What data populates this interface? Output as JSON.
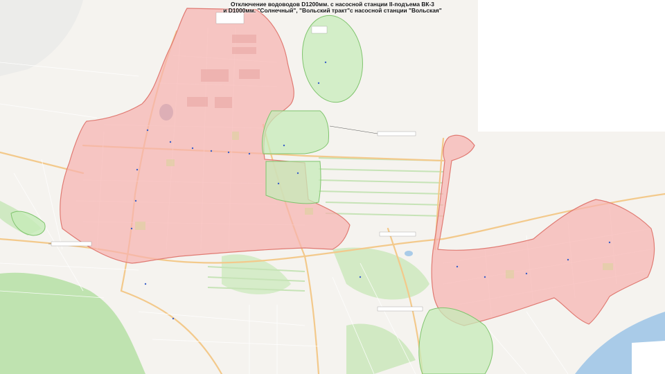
{
  "title": {
    "line1": "Отключение водоводов D1200мм.  с насосной станции II-подъема ВК-3",
    "line2": "и D1000мм. \"Солнечный\", \"Вольский тракт\"с насосной станции \"Вольская\""
  },
  "legend_zones": {
    "affected_fill": "#f6b3b0",
    "affected_stroke": "#e07a72",
    "unaffected_fill": "#c5ebb8",
    "unaffected_stroke": "#7fc46d"
  },
  "colors": {
    "map_bg": "#f5f3ef",
    "park_green": "#bfe3b0",
    "road_major": "#f3c98b",
    "road_minor": "#ffffff",
    "river": "#a9cbe8",
    "callout_line": "#555555"
  }
}
